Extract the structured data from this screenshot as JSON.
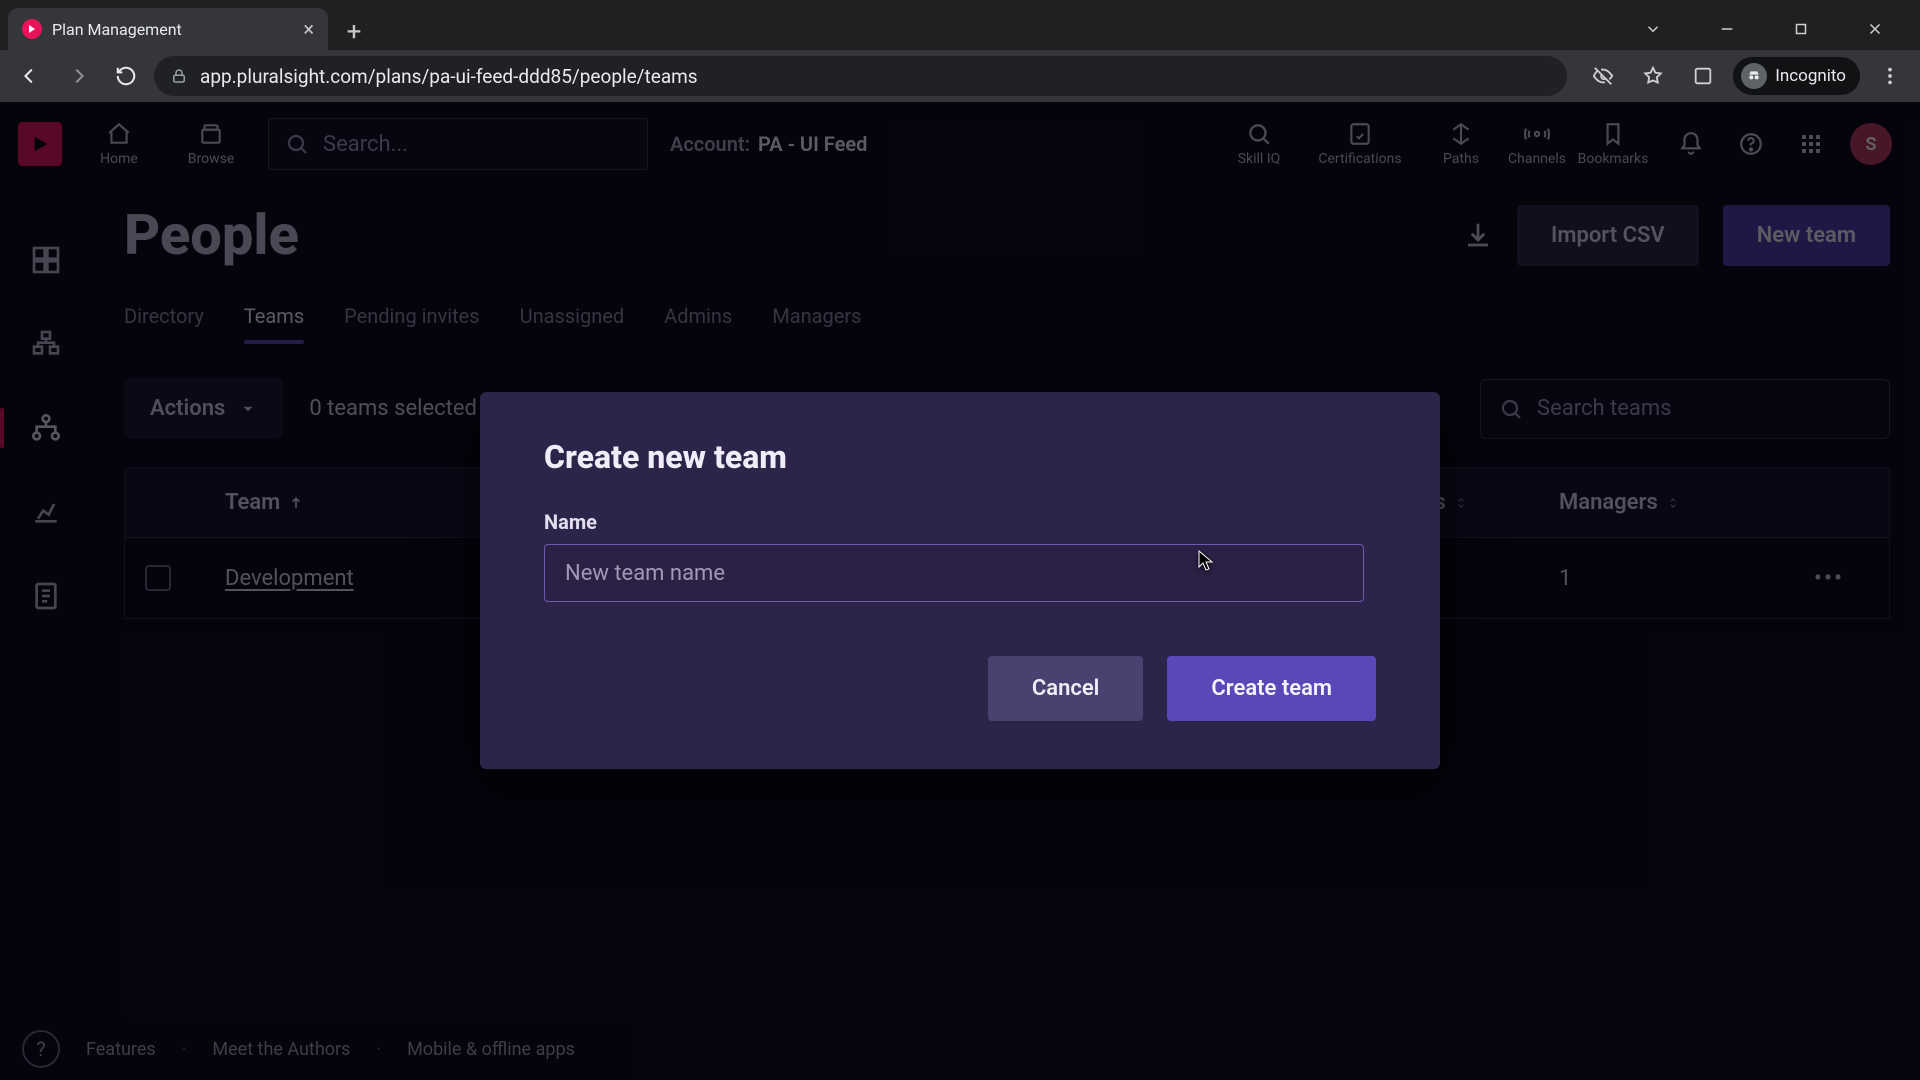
{
  "browser": {
    "tab_title": "Plan Management",
    "url": "app.pluralsight.com/plans/pa-ui-feed-ddd85/people/teams",
    "incognito_label": "Incognito"
  },
  "topbar": {
    "nav": {
      "home": "Home",
      "browse": "Browse",
      "skilliq": "Skill IQ",
      "certifications": "Certifications",
      "paths": "Paths",
      "channels": "Channels",
      "bookmarks": "Bookmarks"
    },
    "search_placeholder": "Search...",
    "account_label": "Account:",
    "account_value": "PA - UI Feed",
    "avatar_initial": "S"
  },
  "page": {
    "title": "People",
    "import_csv": "Import CSV",
    "new_team": "New team",
    "tabs": {
      "directory": "Directory",
      "teams": "Teams",
      "pending": "Pending invites",
      "unassigned": "Unassigned",
      "admins": "Admins",
      "managers": "Managers"
    },
    "actions_label": "Actions",
    "selection_text": "0 teams selected",
    "search_teams_placeholder": "Search teams",
    "columns": {
      "team": "Team",
      "learners": "Learners",
      "managers": "Managers"
    },
    "rows": [
      {
        "name": "Development",
        "learners": "",
        "managers": "1"
      }
    ]
  },
  "footer": {
    "features": "Features",
    "authors": "Meet the Authors",
    "mobile": "Mobile & offline apps"
  },
  "modal": {
    "title": "Create new team",
    "name_label": "Name",
    "name_placeholder": "New team name",
    "cancel": "Cancel",
    "create": "Create team"
  }
}
